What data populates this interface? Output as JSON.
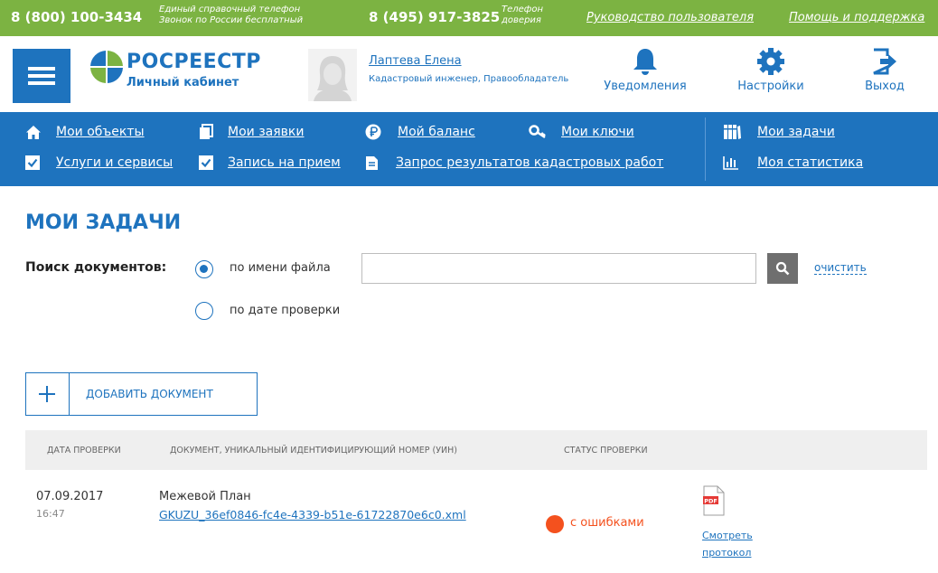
{
  "topbar": {
    "phone1": "8 (800) 100-3434",
    "phone1_note_line1": "Единый справочный телефон",
    "phone1_note_line2": "Звонок по России бесплатный",
    "phone2": "8 (495) 917-3825",
    "phone2_note_line1": "Телефон",
    "phone2_note_line2": "доверия",
    "link_manual": "Руководство пользователя",
    "link_help": "Помощь и поддержка"
  },
  "header": {
    "logo_title": "РОСРЕЕСТР",
    "logo_subtitle": "Личный кабинет",
    "user_name": "Лаптева Елена",
    "user_role": "Кадастровый инженер, Правообладатель",
    "notifications": "Уведомления",
    "settings": "Настройки",
    "logout": "Выход"
  },
  "nav": {
    "row1": [
      {
        "label": "Мои объекты",
        "icon": "home-icon"
      },
      {
        "label": "Мои заявки",
        "icon": "documents-icon"
      },
      {
        "label": "Мой баланс",
        "icon": "ruble-icon"
      },
      {
        "label": "Мои ключи",
        "icon": "key-icon"
      },
      {
        "label": "Мои задачи",
        "icon": "binders-icon"
      }
    ],
    "row2": [
      {
        "label": "Услуги и сервисы",
        "icon": "checkbox-icon"
      },
      {
        "label": "Запись на прием",
        "icon": "checkbox-icon"
      },
      {
        "label": "Запрос результатов кадастровых работ",
        "icon": "file-icon"
      },
      {
        "label": "Моя статистика",
        "icon": "bar-chart-icon"
      }
    ]
  },
  "main": {
    "title": "МОИ ЗАДАЧИ",
    "search_label": "Поиск документов:",
    "radio_by_name": "по имени файла",
    "radio_by_date": "по дате проверки",
    "search_value": "",
    "clear_label": "очистить",
    "add_document": "ДОБАВИТЬ ДОКУМЕНТ"
  },
  "table": {
    "columns": [
      "ДАТА ПРОВЕРКИ",
      "ДОКУМЕНТ, УНИКАЛЬНЫЙ ИДЕНТИФИЦИРУЮЩИЙ НОМЕР (УИН)",
      "СТАТУС ПРОВЕРКИ"
    ],
    "rows": [
      {
        "date": "07.09.2017",
        "time": "16:47",
        "doc_type": "Межевой План",
        "file": "GKUZU_36ef0846-fc4e-4339-b51e-61722870e6c0.xml",
        "status": "с ошибками",
        "pdf_badge": "PDF",
        "view_link_line1": "Смотреть",
        "view_link_line2": "протокол"
      }
    ]
  },
  "colors": {
    "brand_blue": "#1e73be",
    "topbar_green": "#7cb342",
    "error_orange": "#f4511e"
  }
}
